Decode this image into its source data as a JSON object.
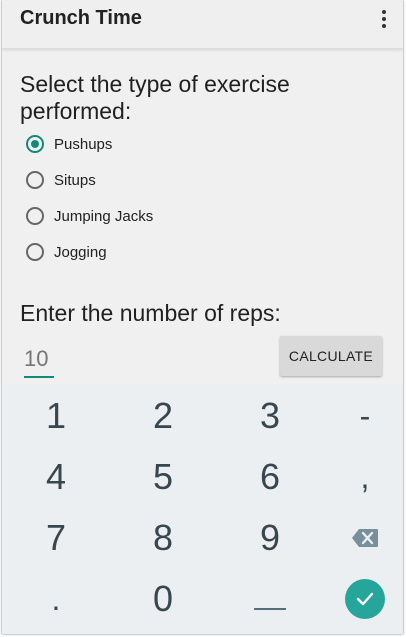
{
  "app": {
    "title": "Crunch Time"
  },
  "form": {
    "exercise_prompt": "Select the type of exercise performed:",
    "exercise_options": [
      "Pushups",
      "Situps",
      "Jumping Jacks",
      "Jogging"
    ],
    "selected_exercise": "Pushups",
    "reps_prompt": "Enter the number of reps:",
    "reps_placeholder": "10",
    "calculate_label": "CALCULATE"
  },
  "keypad": {
    "rows": [
      [
        "1",
        "2",
        "3",
        "-"
      ],
      [
        "4",
        "5",
        "6",
        ","
      ],
      [
        "7",
        "8",
        "9",
        "backspace-icon"
      ],
      [
        ".",
        "0",
        "space-key",
        "done-check-icon"
      ]
    ]
  },
  "colors": {
    "accent": "#13897a",
    "done": "#26a69a",
    "keypad_bg": "#eceff1",
    "key_text": "#37474f"
  }
}
